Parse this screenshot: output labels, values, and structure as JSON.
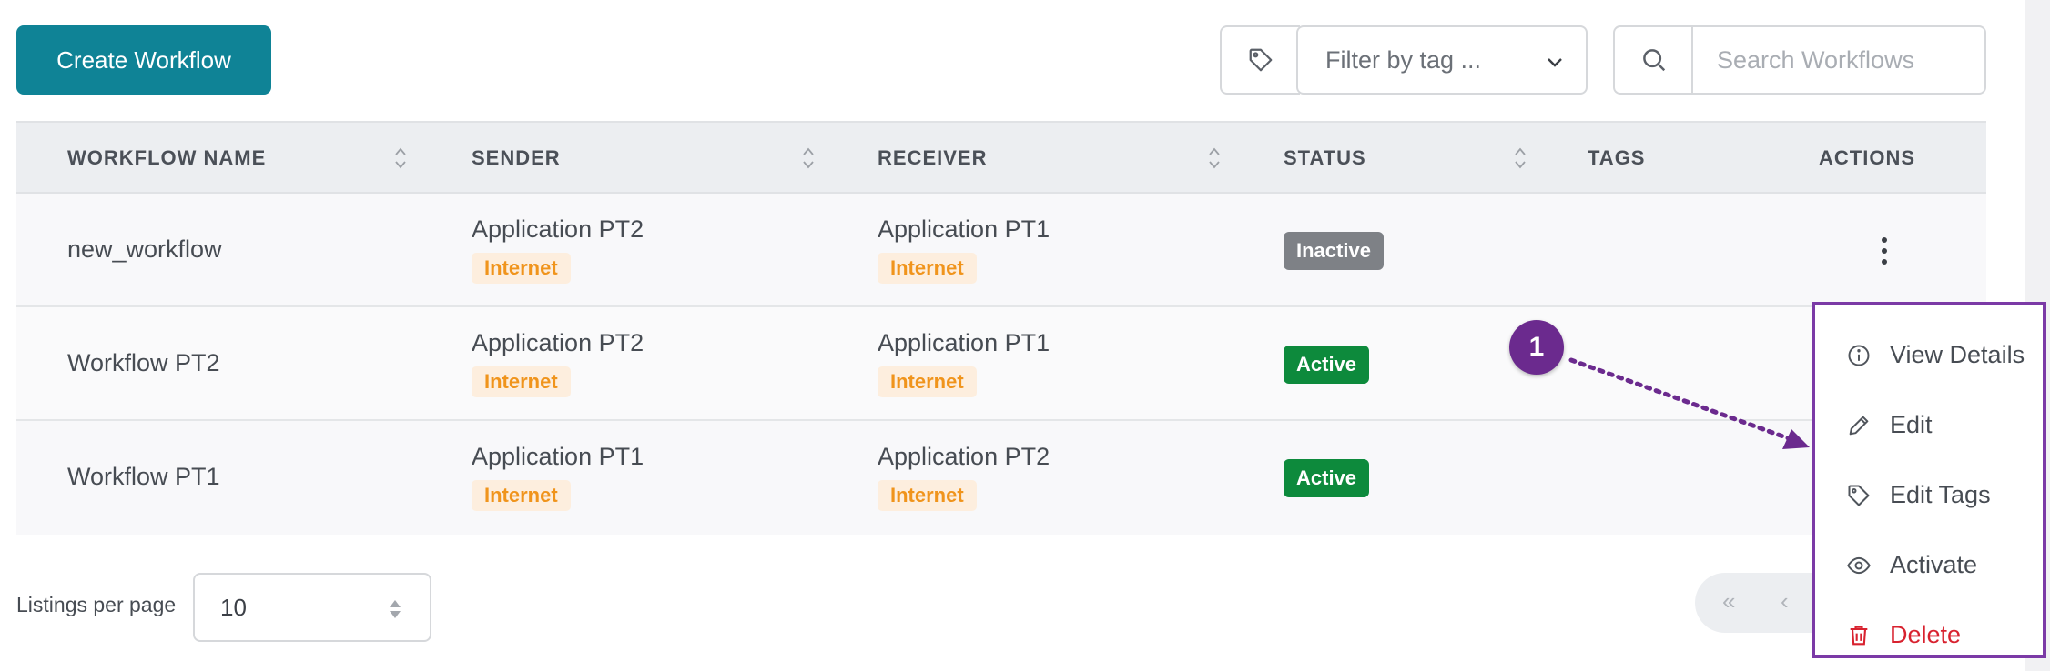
{
  "toolbar": {
    "create_label": "Create Workflow",
    "filter_placeholder": "Filter by tag ...",
    "search_placeholder": "Search Workflows"
  },
  "table": {
    "headers": [
      "WORKFLOW NAME",
      "SENDER",
      "RECEIVER",
      "STATUS",
      "TAGS",
      "ACTIONS"
    ],
    "rows": [
      {
        "name": "new_workflow",
        "sender": "Application PT2",
        "sender_tag": "Internet",
        "receiver": "Application PT1",
        "receiver_tag": "Internet",
        "status": "Inactive"
      },
      {
        "name": "Workflow PT2",
        "sender": "Application PT2",
        "sender_tag": "Internet",
        "receiver": "Application PT1",
        "receiver_tag": "Internet",
        "status": "Active"
      },
      {
        "name": "Workflow PT1",
        "sender": "Application PT1",
        "sender_tag": "Internet",
        "receiver": "Application PT2",
        "receiver_tag": "Internet",
        "status": "Active"
      }
    ]
  },
  "pagination": {
    "per_page_label": "Listings per page",
    "per_page_value": "10",
    "first": "«",
    "prev": "‹"
  },
  "callout": {
    "number": "1"
  },
  "menu": {
    "items": [
      {
        "label": "View Details",
        "icon": "info-icon"
      },
      {
        "label": "Edit",
        "icon": "pencil-icon"
      },
      {
        "label": "Edit Tags",
        "icon": "tag-icon"
      },
      {
        "label": "Activate",
        "icon": "eye-icon"
      },
      {
        "label": "Delete",
        "icon": "trash-icon"
      }
    ]
  },
  "colors": {
    "primary": "#0f8396",
    "active": "#0d8a3c",
    "inactive": "#7e8186",
    "internet_tag_bg": "#fdeede",
    "internet_tag_text": "#f0941c",
    "callout": "#6b2a8e",
    "delete": "#d8222f"
  }
}
